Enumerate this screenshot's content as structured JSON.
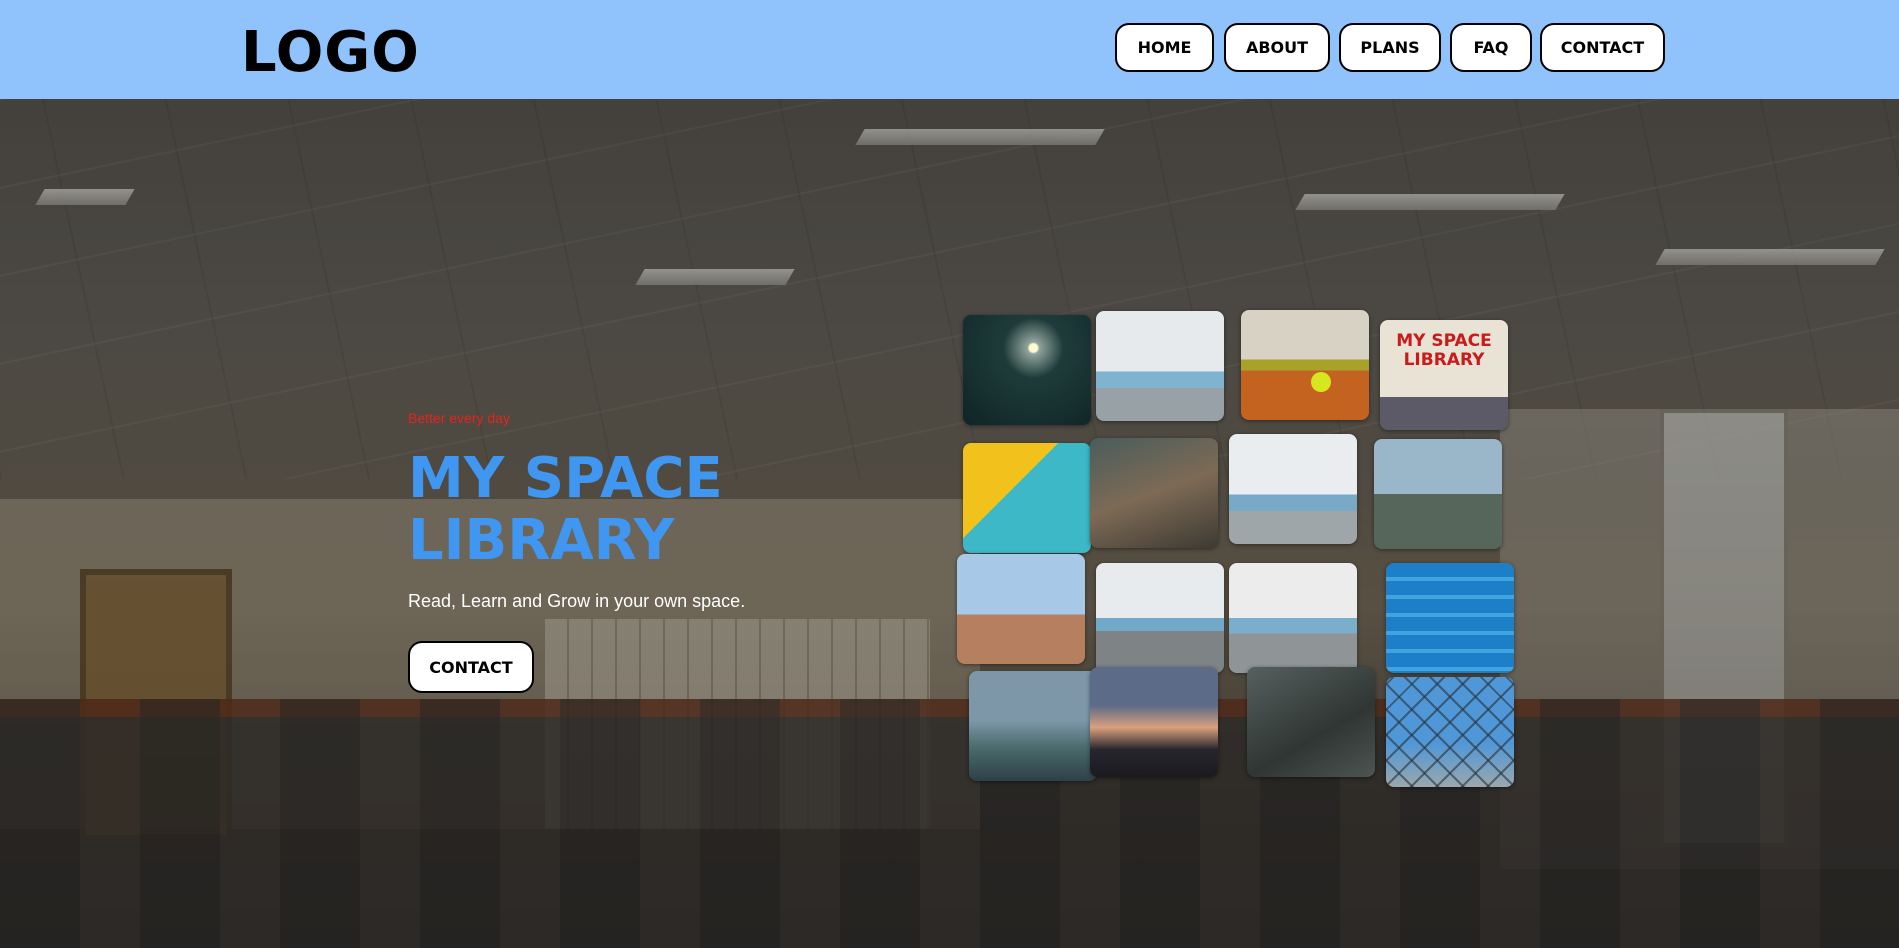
{
  "header": {
    "logo": "LOGO",
    "nav": [
      "HOME",
      "ABOUT",
      "PLANS",
      "FAQ",
      "CONTACT"
    ]
  },
  "hero": {
    "tagline": "Better every day",
    "title": "MY SPACE LIBRARY",
    "subtitle": "Read, Learn and Grow in your own space.",
    "cta": "CONTACT"
  },
  "collage": {
    "sign_text": "MY SPACE LIBRARY"
  },
  "colors": {
    "header_bg": "#90c2fb",
    "title": "#3f97f2",
    "tagline": "#e8231e",
    "button_bg": "#ffffff",
    "button_border": "#000000"
  }
}
